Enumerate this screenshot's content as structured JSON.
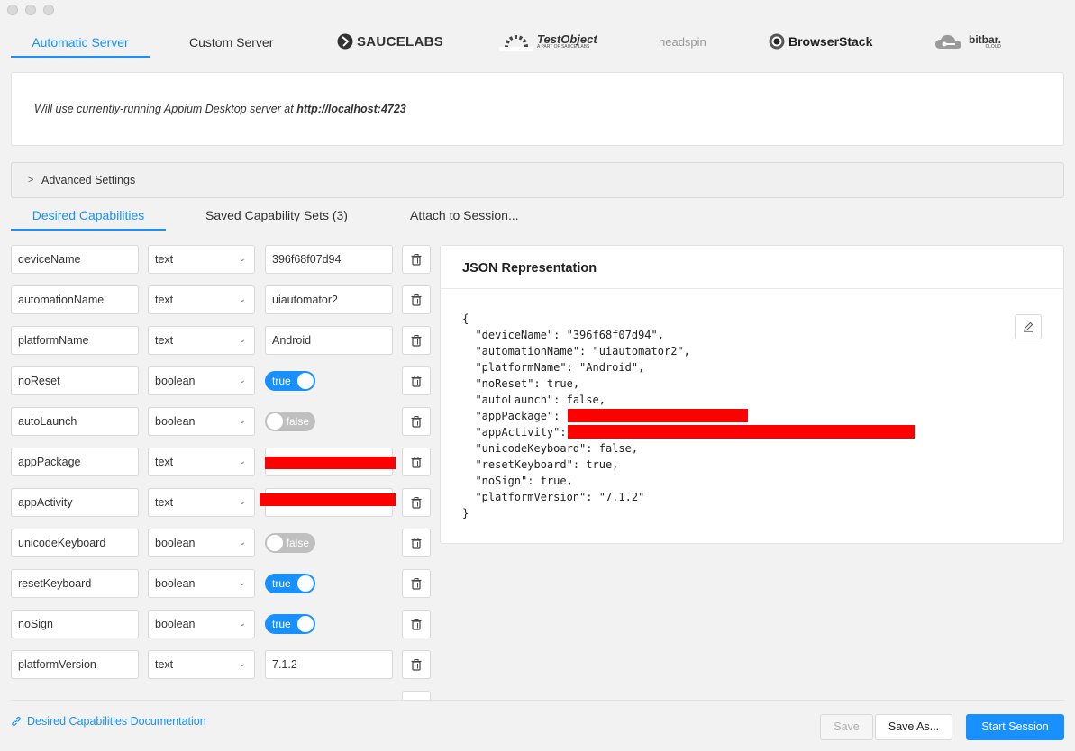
{
  "window": {
    "traffic_lights": [
      "close",
      "minimize",
      "zoom"
    ]
  },
  "server_tabs": {
    "automatic": "Automatic Server",
    "custom": "Custom Server",
    "saucelabs": "SAUCELABS",
    "testobject": "TestObject",
    "testobject_sub": "A PART OF SAUCE LABS",
    "headspin": "headspin",
    "browserstack": "BrowserStack",
    "bitbar": "bitbar.",
    "bitbar_sub": "CLOUD"
  },
  "server_info": {
    "prefix": "Will use currently-running Appium Desktop server at ",
    "url": "http://localhost:4723"
  },
  "advanced": {
    "label": "Advanced Settings",
    "arrow": ">"
  },
  "cap_tabs": {
    "desired": "Desired Capabilities",
    "saved": "Saved Capability Sets (3)",
    "attach": "Attach to Session..."
  },
  "capabilities": [
    {
      "name": "deviceName",
      "type": "text",
      "value": "396f68f07d94"
    },
    {
      "name": "automationName",
      "type": "text",
      "value": "uiautomator2"
    },
    {
      "name": "platformName",
      "type": "text",
      "value": "Android"
    },
    {
      "name": "noReset",
      "type": "boolean",
      "value": "true"
    },
    {
      "name": "autoLaunch",
      "type": "boolean",
      "value": "false"
    },
    {
      "name": "appPackage",
      "type": "text",
      "value": ""
    },
    {
      "name": "appActivity",
      "type": "text",
      "value": ""
    },
    {
      "name": "unicodeKeyboard",
      "type": "boolean",
      "value": "false"
    },
    {
      "name": "resetKeyboard",
      "type": "boolean",
      "value": "true"
    },
    {
      "name": "noSign",
      "type": "boolean",
      "value": "true"
    },
    {
      "name": "platformVersion",
      "type": "text",
      "value": "7.1.2"
    }
  ],
  "json_panel": {
    "title": "JSON Representation",
    "lines": [
      "{",
      "  \"deviceName\": \"396f68f07d94\",",
      "  \"automationName\": \"uiautomator2\",",
      "  \"platformName\": \"Android\",",
      "  \"noReset\": true,",
      "  \"autoLaunch\": false,",
      "  \"appPackage\": ",
      "  \"appActivity\":",
      "  \"unicodeKeyboard\": false,",
      "  \"resetKeyboard\": true,",
      "  \"noSign\": true,",
      "  \"platformVersion\": \"7.1.2\"",
      "}"
    ]
  },
  "footer": {
    "doc_link": "Desired Capabilities Documentation",
    "save": "Save",
    "save_as": "Save As...",
    "start": "Start Session"
  },
  "colors": {
    "accent": "#1890ff",
    "redaction": "#ff0000",
    "toggle_off": "#bfbfbf"
  }
}
